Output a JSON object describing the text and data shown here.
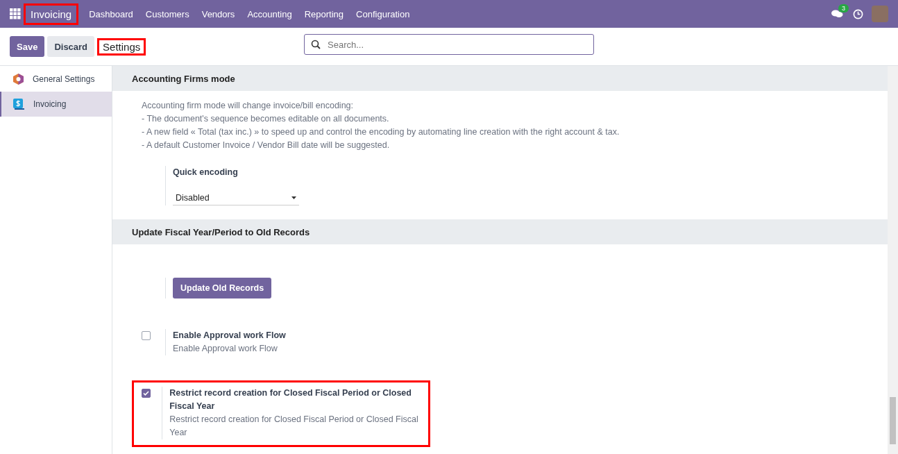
{
  "navbar": {
    "app_name": "Invoicing",
    "app_name_highlighted": true,
    "menu": [
      "Dashboard",
      "Customers",
      "Vendors",
      "Accounting",
      "Reporting",
      "Configuration"
    ],
    "message_count": "3"
  },
  "control_bar": {
    "buttons": [
      {
        "label": "Save",
        "kind": "primary"
      },
      {
        "label": "Discard",
        "kind": "secondary"
      }
    ],
    "breadcrumb": "Settings",
    "breadcrumb_highlighted": true,
    "search": {
      "placeholder": "Search..."
    }
  },
  "sidebar": {
    "items": [
      {
        "label": "General Settings",
        "kind": "general",
        "selected": false
      },
      {
        "label": "Invoicing",
        "kind": "invoicing",
        "selected": true
      }
    ]
  },
  "sections": [
    {
      "title": "Accounting Firms mode",
      "description": [
        "Accounting firm mode will change invoice/bill encoding:",
        "- The document's sequence becomes editable on all documents.",
        "- A new field « Total (tax inc.) » to speed up and control the encoding by automating line creation with the right account & tax.",
        "- A default Customer Invoice / Vendor Bill date will be suggested."
      ],
      "settings": [
        {
          "kind": "select",
          "label": "Quick encoding",
          "value": "Disabled"
        }
      ]
    },
    {
      "title": "Update Fiscal Year/Period to Old Records",
      "settings": [
        {
          "kind": "button",
          "label": "Update Old Records"
        },
        {
          "kind": "checkbox",
          "label": "Enable Approval work Flow",
          "help": "Enable Approval work Flow",
          "checked": false,
          "highlighted": false
        },
        {
          "kind": "checkbox",
          "label": "Restrict record creation for Closed Fiscal Period or Closed Fiscal Year",
          "help": "Restrict record creation for Closed Fiscal Period or Closed Fiscal Year",
          "checked": true,
          "highlighted": true
        }
      ]
    }
  ]
}
